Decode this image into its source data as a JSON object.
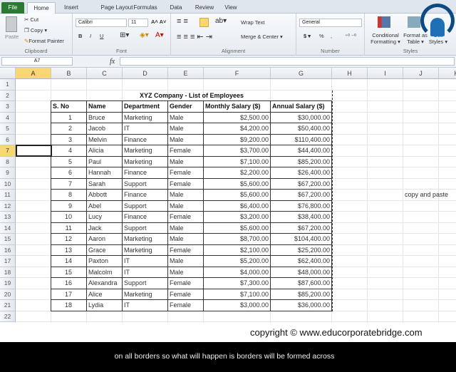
{
  "tabs": [
    "File",
    "Home",
    "Insert",
    "Page Layout",
    "Formulas",
    "Data",
    "Review",
    "View"
  ],
  "ribbon": {
    "clipboard": {
      "paste": "Paste",
      "cut": "Cut",
      "copy": "Copy ▾",
      "format_painter": "Format Painter",
      "label": "Clipboard"
    },
    "font": {
      "name": "Calibri",
      "size": "11",
      "bold": "B",
      "italic": "I",
      "underline": "U",
      "label": "Font"
    },
    "alignment": {
      "wrap": "Wrap Text",
      "merge": "Merge & Center ▾",
      "label": "Alignment"
    },
    "number": {
      "format": "General",
      "currency": "$ ▾",
      "percent": "%",
      "comma": ",",
      "label": "Number"
    },
    "styles": {
      "conditional": "Conditional Formatting ▾",
      "format_table": "Format as Table ▾",
      "cell_styles": "Cell Styles ▾",
      "label": "Styles"
    }
  },
  "formula_bar": {
    "name_box": "A7",
    "fx": "fx",
    "value": ""
  },
  "columns": [
    "A",
    "B",
    "C",
    "D",
    "E",
    "F",
    "G",
    "H",
    "I",
    "J",
    "K"
  ],
  "rows": [
    "1",
    "2",
    "3",
    "4",
    "5",
    "6",
    "7",
    "8",
    "9",
    "10",
    "11",
    "12",
    "13",
    "14",
    "15",
    "16",
    "17",
    "18",
    "19",
    "20",
    "21",
    "22"
  ],
  "selected_cell": "A7",
  "sheet": {
    "title": "XYZ Company - List of Employees",
    "headers": [
      "S. No",
      "Name",
      "Department",
      "Gender",
      "Monthly Salary ($)",
      "Annual Salary ($)"
    ],
    "records": [
      [
        "1",
        "Bruce",
        "Marketing",
        "Male",
        "$2,500.00",
        "$30,000.00"
      ],
      [
        "2",
        "Jacob",
        "IT",
        "Male",
        "$4,200.00",
        "$50,400.00"
      ],
      [
        "3",
        "Melvin",
        "Finance",
        "Male",
        "$9,200.00",
        "$110,400.00"
      ],
      [
        "4",
        "Alicia",
        "Marketing",
        "Female",
        "$3,700.00",
        "$44,400.00"
      ],
      [
        "5",
        "Paul",
        "Marketing",
        "Male",
        "$7,100.00",
        "$85,200.00"
      ],
      [
        "6",
        "Hannah",
        "Finance",
        "Female",
        "$2,200.00",
        "$26,400.00"
      ],
      [
        "7",
        "Sarah",
        "Support",
        "Female",
        "$5,600.00",
        "$67,200.00"
      ],
      [
        "8",
        "Abbott",
        "Finance",
        "Male",
        "$5,600.00",
        "$67,200.00"
      ],
      [
        "9",
        "Abel",
        "Support",
        "Male",
        "$6,400.00",
        "$76,800.00"
      ],
      [
        "10",
        "Lucy",
        "Finance",
        "Female",
        "$3,200.00",
        "$38,400.00"
      ],
      [
        "11",
        "Jack",
        "Support",
        "Male",
        "$5,600.00",
        "$67,200.00"
      ],
      [
        "12",
        "Aaron",
        "Marketing",
        "Male",
        "$8,700.00",
        "$104,400.00"
      ],
      [
        "13",
        "Grace",
        "Marketing",
        "Female",
        "$2,100.00",
        "$25,200.00"
      ],
      [
        "14",
        "Paxton",
        "IT",
        "Male",
        "$5,200.00",
        "$62,400.00"
      ],
      [
        "15",
        "Malcolm",
        "IT",
        "Male",
        "$4,000.00",
        "$48,000.00"
      ],
      [
        "16",
        "Alexandra",
        "Support",
        "Female",
        "$7,300.00",
        "$87,600.00"
      ],
      [
        "17",
        "Alice",
        "Marketing",
        "Female",
        "$7,100.00",
        "$85,200.00"
      ],
      [
        "18",
        "Lydia",
        "IT",
        "Female",
        "$3,000.00",
        "$36,000.00"
      ]
    ],
    "note": "copy and paste"
  },
  "overlay": {
    "copyright": "copyright © www.educorporatebridge.com",
    "subtitle": "on all borders  so what will happen is  borders will be formed across"
  }
}
